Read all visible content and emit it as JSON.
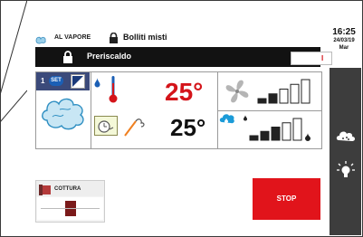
{
  "header": {
    "mode_label": "AL VAPORE",
    "program_name": "Bolliti misti"
  },
  "clock": {
    "time": "16:25",
    "date": "24/03/19",
    "weekday": "Mar"
  },
  "status": {
    "label": "Preriscaldo",
    "toggle_mark": "I"
  },
  "phase": {
    "number": "1",
    "set_label": "SET"
  },
  "temperatures": {
    "chamber_set": "25°",
    "core": "25°"
  },
  "fan": {
    "level": 2,
    "max": 5
  },
  "humidity": {
    "level": 3,
    "max": 5
  },
  "bottom": {
    "cottura_label": "COTTURA",
    "stop_label": "STOP"
  },
  "colors": {
    "accent_red": "#e1141b",
    "rail_gray": "#3d3d3d",
    "status_black": "#121212",
    "thermo_blue": "#1b5fb5"
  }
}
